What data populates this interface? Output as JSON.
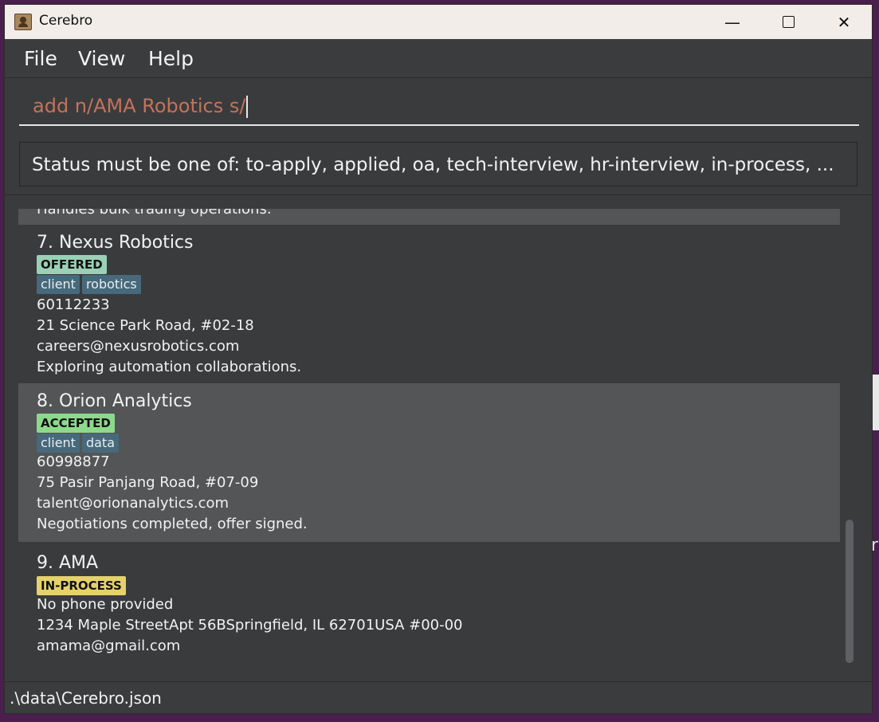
{
  "window": {
    "title": "Cerebro"
  },
  "menu": {
    "file": "File",
    "view": "View",
    "help": "Help"
  },
  "command": {
    "value": "add n/AMA Robotics s/"
  },
  "result": {
    "message": "Status must be one of: to-apply, applied, oa, tech-interview, hr-interview, in-process, ..."
  },
  "list": {
    "partial_line": "Handles bulk trading operations.",
    "cards": [
      {
        "name": "7. Nexus Robotics",
        "status": "OFFERED",
        "tags": [
          "client",
          "robotics"
        ],
        "phone": "60112233",
        "address": "21 Science Park Road, #02-18",
        "email": "careers@nexusrobotics.com",
        "note": "Exploring automation collaborations."
      },
      {
        "name": "8. Orion Analytics",
        "status": "ACCEPTED",
        "tags": [
          "client",
          "data"
        ],
        "phone": "60998877",
        "address": "75 Pasir Panjang Road, #07-09",
        "email": "talent@orionanalytics.com",
        "note": "Negotiations completed, offer signed."
      },
      {
        "name": "9. AMA",
        "status": "IN-PROCESS",
        "phone": "No phone provided",
        "address": "1234 Maple StreetApt 56BSpringfield, IL 62701USA #00-00",
        "email": "amama@gmail.com"
      }
    ]
  },
  "statusbar": {
    "path": ".\\data\\Cerebro.json"
  },
  "colors": {
    "offered": "#9ad0b7",
    "accepted": "#8dd98b",
    "in_process": "#e5d26b",
    "tag": "#47697b",
    "command_text": "#c3735a"
  },
  "desktop": {
    "glyph": "r"
  }
}
